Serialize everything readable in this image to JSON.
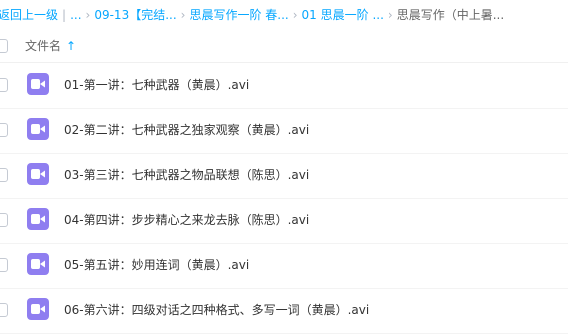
{
  "breadcrumb": {
    "items": [
      "返回上一级",
      "...",
      "09-13【完结...",
      "思晨写作一阶 春...",
      "01 思晨一阶 ..."
    ],
    "current": "思晨写作（中上暑..."
  },
  "list_header": {
    "column_label": "文件名",
    "sort_icon": "arrow-up-icon"
  },
  "files": [
    {
      "name": "01-第一讲：七种武器（黄晨）.avi",
      "icon": "video-file-icon"
    },
    {
      "name": "02-第二讲：七种武器之独家观察（黄晨）.avi",
      "icon": "video-file-icon"
    },
    {
      "name": "03-第三讲：七种武器之物品联想（陈思）.avi",
      "icon": "video-file-icon"
    },
    {
      "name": "04-第四讲：步步精心之来龙去脉（陈思）.avi",
      "icon": "video-file-icon"
    },
    {
      "name": "05-第五讲：妙用连词（黄晨）.avi",
      "icon": "video-file-icon"
    },
    {
      "name": "06-第六讲：四级对话之四种格式、多写一词（黄晨）.avi",
      "icon": "video-file-icon"
    }
  ],
  "colors": {
    "accent": "#06a7ff",
    "video_icon": "#8f7ef0"
  }
}
